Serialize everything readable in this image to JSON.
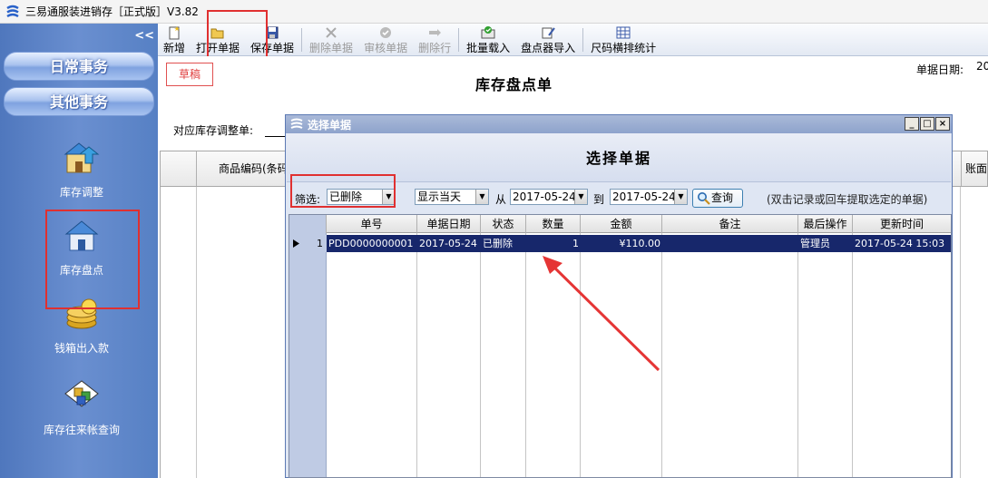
{
  "app": {
    "title": "三易通服装进销存［正式版］V3.82"
  },
  "sidebar": {
    "collapse": "<<",
    "nav": [
      "日常事务",
      "其他事务"
    ],
    "items": [
      {
        "label": "库存调整",
        "icon": "stock-adjust-icon"
      },
      {
        "label": "库存盘点",
        "icon": "stock-count-icon"
      },
      {
        "label": "钱箱出入款",
        "icon": "cash-box-icon"
      },
      {
        "label": "库存往来帐查询",
        "icon": "ledger-query-icon"
      }
    ]
  },
  "toolbar": {
    "new": "新增",
    "open": "打开单据",
    "save": "保存单据",
    "delete_doc": "删除单据",
    "audit": "审核单据",
    "delete_row": "删除行",
    "batch_load": "批量载入",
    "scanner_import": "盘点器导入",
    "size_stats": "尺码横排统计"
  },
  "form": {
    "status_badge": "草稿",
    "title": "库存盘点单",
    "date_label": "单据日期:",
    "date_value": "20",
    "adjust_label": "对应库存调整单:",
    "col_product": "商品编码(条码",
    "col_right": "账面"
  },
  "dialog": {
    "title": "选择单据",
    "heading": "选择单据",
    "filter_label": "筛选:",
    "filter_value": "已删除",
    "range_value": "显示当天",
    "from_label": "从",
    "from_date": "2017-05-24",
    "to_label": "到",
    "to_date": "2017-05-24",
    "query_label": "查询",
    "hint": "(双击记录或回车提取选定的单据)",
    "columns": [
      "单号",
      "单据日期",
      "状态",
      "数量",
      "金额",
      "备注",
      "最后操作",
      "更新时间"
    ],
    "rows": [
      {
        "index": "1",
        "no": "PDD0000000001",
        "date": "2017-05-24",
        "status": "已删除",
        "qty": "1",
        "amount": "¥110.00",
        "remark": "",
        "operator": "管理员",
        "updated": "2017-05-24 15:03"
      }
    ]
  },
  "colors": {
    "highlight_red": "#e03030",
    "selected_row": "#17276b",
    "sidebar_blue": "#5a82c6"
  }
}
